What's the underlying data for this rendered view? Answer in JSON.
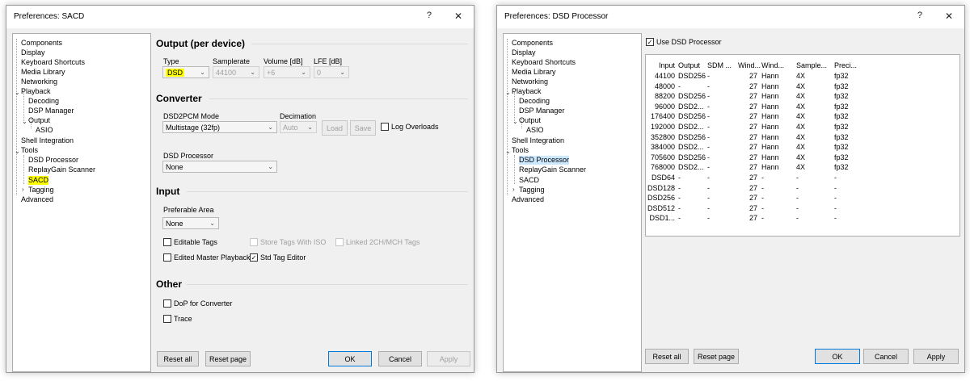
{
  "left": {
    "title": "Preferences: SACD",
    "help_glyph": "?",
    "close_glyph": "✕",
    "tree": [
      "Components",
      "Display",
      "Keyboard Shortcuts",
      "Media Library",
      "Networking",
      "Playback",
      "Decoding",
      "DSP Manager",
      "Output",
      "ASIO",
      "Shell Integration",
      "Tools",
      "DSD Processor",
      "ReplayGain Scanner",
      "SACD",
      "Tagging",
      "Advanced"
    ],
    "output_section": {
      "title": "Output (per device)",
      "type_label": "Type",
      "type_value": "DSD",
      "samplerate_label": "Samplerate",
      "samplerate_value": "44100",
      "volume_label": "Volume [dB]",
      "volume_value": "+6",
      "lfe_label": "LFE [dB]",
      "lfe_value": "0"
    },
    "converter_section": {
      "title": "Converter",
      "mode_label": "DSD2PCM Mode",
      "mode_value": "Multistage (32fp)",
      "decimation_label": "Decimation",
      "decimation_value": "Auto",
      "load": "Load",
      "save": "Save",
      "log_overloads": "Log Overloads",
      "dsd_processor_label": "DSD Processor",
      "dsd_processor_value": "None"
    },
    "input_section": {
      "title": "Input",
      "area_label": "Preferable Area",
      "area_value": "None",
      "editable_tags": "Editable Tags",
      "store_tags_iso": "Store Tags With ISO",
      "linked_tags": "Linked 2CH/MCH Tags",
      "edited_master": "Edited Master Playback",
      "std_tag_editor": "Std Tag Editor"
    },
    "other_section": {
      "title": "Other",
      "dop": "DoP for Converter",
      "trace": "Trace"
    },
    "buttons": {
      "reset_all": "Reset all",
      "reset_page": "Reset page",
      "ok": "OK",
      "cancel": "Cancel",
      "apply": "Apply"
    }
  },
  "right": {
    "title": "Preferences: DSD Processor",
    "help_glyph": "?",
    "close_glyph": "✕",
    "use_dsd_processor": "Use DSD Processor",
    "headers": [
      "Input",
      "Output",
      "SDM ...",
      "Wind...",
      "Wind...",
      "Sample...",
      "Preci..."
    ],
    "rows": [
      [
        "44100",
        "DSD256",
        "-",
        "27",
        "Hann",
        "4X",
        "fp32"
      ],
      [
        "48000",
        "-",
        "-",
        "27",
        "Hann",
        "4X",
        "fp32"
      ],
      [
        "88200",
        "DSD256",
        "-",
        "27",
        "Hann",
        "4X",
        "fp32"
      ],
      [
        "96000",
        "DSD2...",
        "-",
        "27",
        "Hann",
        "4X",
        "fp32"
      ],
      [
        "176400",
        "DSD256",
        "-",
        "27",
        "Hann",
        "4X",
        "fp32"
      ],
      [
        "192000",
        "DSD2...",
        "-",
        "27",
        "Hann",
        "4X",
        "fp32"
      ],
      [
        "352800",
        "DSD256",
        "-",
        "27",
        "Hann",
        "4X",
        "fp32"
      ],
      [
        "384000",
        "DSD2...",
        "-",
        "27",
        "Hann",
        "4X",
        "fp32"
      ],
      [
        "705600",
        "DSD256",
        "-",
        "27",
        "Hann",
        "4X",
        "fp32"
      ],
      [
        "768000",
        "DSD2...",
        "-",
        "27",
        "Hann",
        "4X",
        "fp32"
      ],
      [
        "DSD64",
        "-",
        "-",
        "27",
        "-",
        "-",
        "-"
      ],
      [
        "DSD128",
        "-",
        "-",
        "27",
        "-",
        "-",
        "-"
      ],
      [
        "DSD256",
        "-",
        "-",
        "27",
        "-",
        "-",
        "-"
      ],
      [
        "DSD512",
        "-",
        "-",
        "27",
        "-",
        "-",
        "-"
      ],
      [
        "DSD1...",
        "-",
        "-",
        "27",
        "-",
        "-",
        "-"
      ]
    ],
    "buttons": {
      "reset_all": "Reset all",
      "reset_page": "Reset page",
      "ok": "OK",
      "cancel": "Cancel",
      "apply": "Apply"
    }
  }
}
